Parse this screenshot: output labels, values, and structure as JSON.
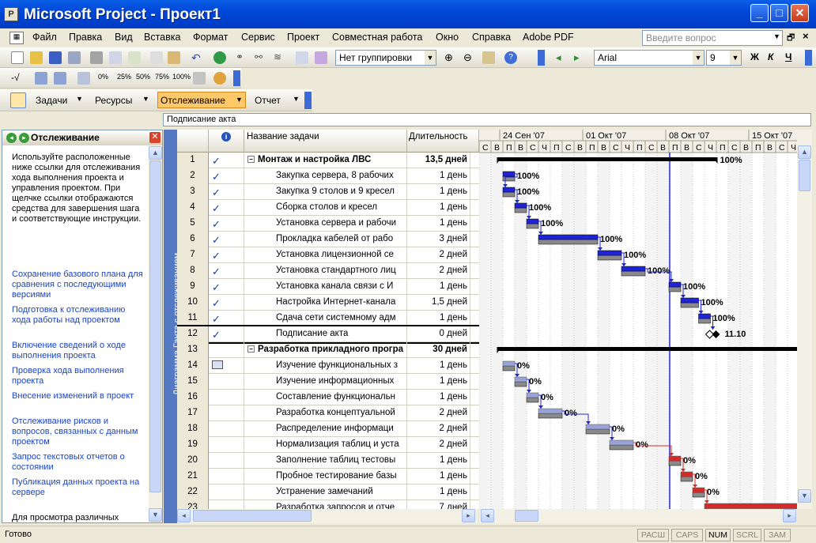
{
  "window": {
    "title": "Microsoft Project - Проект1"
  },
  "menu": [
    "Файл",
    "Правка",
    "Вид",
    "Вставка",
    "Формат",
    "Сервис",
    "Проект",
    "Совместная работа",
    "Окно",
    "Справка",
    "Adobe PDF"
  ],
  "help_placeholder": "Введите вопрос",
  "toolbar": {
    "grouping": "Нет группировки",
    "font": "Arial",
    "font_size": "9",
    "bold": "Ж",
    "italic": "К",
    "underline": "Ч",
    "pct": [
      "0%",
      "25%",
      "50%",
      "75%",
      "100%"
    ]
  },
  "guide_bar": {
    "tasks": "Задачи",
    "resources": "Ресурсы",
    "tracking": "Отслеживание",
    "report": "Отчет"
  },
  "entry_value": "Подписание акта",
  "side_pane": {
    "title": "Отслеживание",
    "intro": "Используйте расположенные ниже ссылки для отслеживания хода выполнения проекта и управления проектом. При щелчке ссылки отображаются средства для завершения шага и соответствующие инструкции.",
    "links": [
      "Сохранение базового плана для сравнения с последующими версиями",
      "Подготовка к отслеживанию хода работы над проектом",
      "Включение сведений о ходе выполнения проекта",
      "Проверка хода выполнения проекта",
      "Внесение изменений в проект",
      "Отслеживание рисков и вопросов, связанных с данным проектом",
      "Запрос текстовых отчетов о состоянии",
      "Публикация данных проекта на сервере"
    ],
    "footer": "Для просмотра различных"
  },
  "view_label": "Диаграмма Ганта с отслеживанием",
  "columns": {
    "name": "Название задачи",
    "duration": "Длительность"
  },
  "tasks": [
    {
      "id": "1",
      "name": "Монтаж и настройка ЛВС",
      "duration": "13,5 дней",
      "done": true,
      "summary": true,
      "pct": "100%"
    },
    {
      "id": "2",
      "name": "Закупка сервера, 8 рабочих",
      "duration": "1 день",
      "done": true,
      "pct": "100%"
    },
    {
      "id": "3",
      "name": "Закупка 9 столов и 9 кресел",
      "duration": "1 день",
      "done": true,
      "pct": "100%"
    },
    {
      "id": "4",
      "name": "Сборка столов и кресел",
      "duration": "1 день",
      "done": true,
      "pct": "100%"
    },
    {
      "id": "5",
      "name": "Установка сервера и рабочи",
      "duration": "1 день",
      "done": true,
      "pct": "100%"
    },
    {
      "id": "6",
      "name": "Прокладка кабелей от рабо",
      "duration": "3 дней",
      "done": true,
      "pct": "100%"
    },
    {
      "id": "7",
      "name": "Установка лицензионной се",
      "duration": "2 дней",
      "done": true,
      "pct": "100%"
    },
    {
      "id": "8",
      "name": "Установка стандартного лиц",
      "duration": "2 дней",
      "done": true,
      "pct": "100%"
    },
    {
      "id": "9",
      "name": "Установка канала связи с И",
      "duration": "1 день",
      "done": true,
      "pct": "100%"
    },
    {
      "id": "10",
      "name": "Настройка Интернет-канала",
      "duration": "1,5 дней",
      "done": true,
      "pct": "100%"
    },
    {
      "id": "11",
      "name": "Сдача сети системному адм",
      "duration": "1 день",
      "done": true,
      "pct": "100%"
    },
    {
      "id": "12",
      "name": "Подписание акта",
      "duration": "0 дней",
      "done": true,
      "pct": "11.10"
    },
    {
      "id": "13",
      "name": "Разработка прикладного програ",
      "duration": "30 дней",
      "summary": true,
      "pct": ""
    },
    {
      "id": "14",
      "name": "Изучение функциональных з",
      "duration": "1 день",
      "note": true,
      "pct": "0%"
    },
    {
      "id": "15",
      "name": "Изучение информационных",
      "duration": "1 день",
      "pct": "0%"
    },
    {
      "id": "16",
      "name": "Составление функциональн",
      "duration": "1 день",
      "pct": "0%"
    },
    {
      "id": "17",
      "name": "Разработка концептуальной",
      "duration": "2 дней",
      "pct": "0%"
    },
    {
      "id": "18",
      "name": "Распределение информаци",
      "duration": "2 дней",
      "pct": "0%"
    },
    {
      "id": "19",
      "name": "Нормализация таблиц и уста",
      "duration": "2 дней",
      "pct": "0%"
    },
    {
      "id": "20",
      "name": "Заполнение таблиц тестовы",
      "duration": "1 день",
      "pct": "0%"
    },
    {
      "id": "21",
      "name": "Пробное тестирование базы",
      "duration": "1 день",
      "pct": "0%"
    },
    {
      "id": "22",
      "name": "Устранение замечаний",
      "duration": "1 день",
      "pct": "0%"
    },
    {
      "id": "23",
      "name": "Разработка запросов и отче",
      "duration": "7 дней",
      "pct": ""
    }
  ],
  "timescale": {
    "weeks": [
      "24 Сен '07",
      "01 Окт '07",
      "08 Окт '07",
      "15 Окт '07"
    ],
    "days": [
      "С",
      "В",
      "П",
      "В",
      "С",
      "Ч",
      "П",
      "С",
      "В",
      "П",
      "В",
      "С",
      "Ч",
      "П",
      "С",
      "В",
      "П",
      "В",
      "С",
      "Ч",
      "П",
      "С",
      "В",
      "П",
      "В",
      "С",
      "Ч"
    ]
  },
  "status": {
    "ready": "Готово",
    "indicators": [
      "РАСШ",
      "CAPS",
      "NUM",
      "SCRL",
      "ЗАМ"
    ],
    "active": "NUM"
  }
}
